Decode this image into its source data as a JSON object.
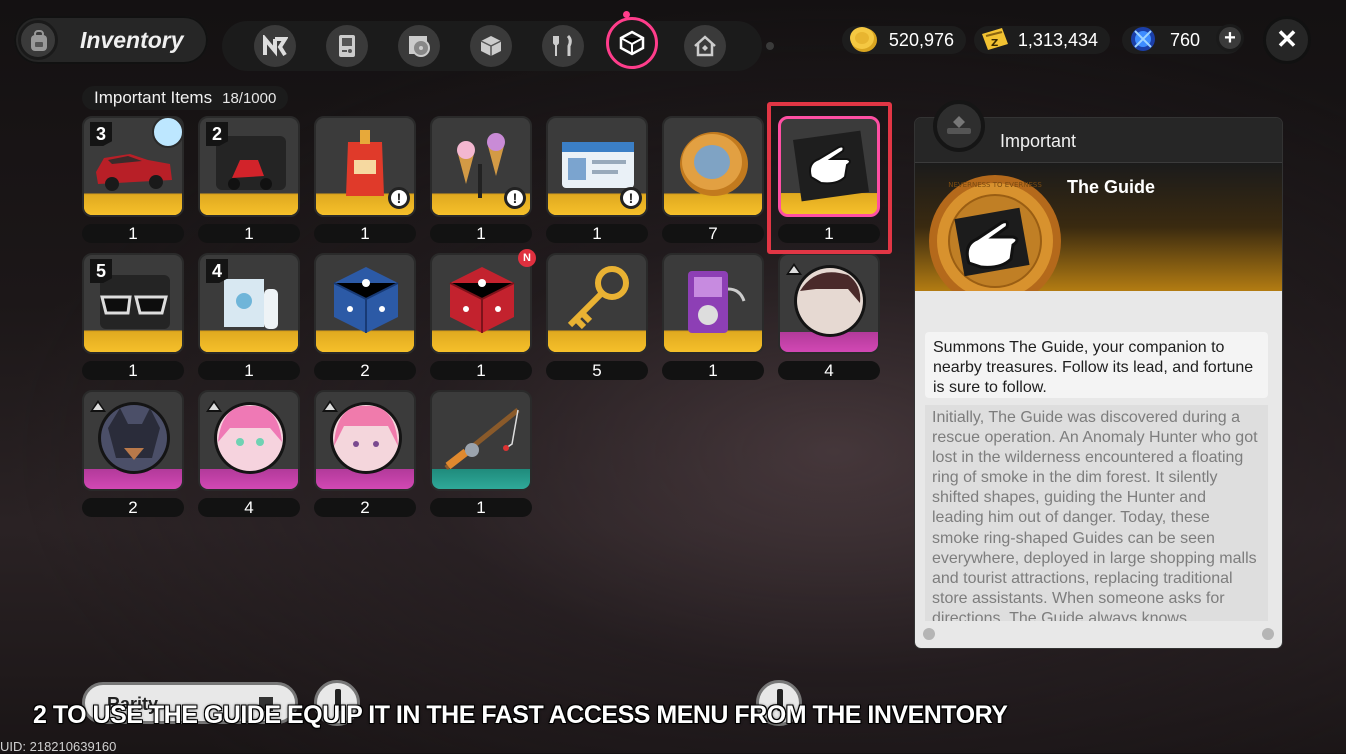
{
  "header": {
    "title": "Inventory"
  },
  "tabs": [
    {
      "name": "tab-bangboo",
      "icon": "n-logo-icon"
    },
    {
      "name": "tab-device",
      "icon": "gameboy-icon"
    },
    {
      "name": "tab-disc",
      "icon": "disc-icon"
    },
    {
      "name": "tab-materials",
      "icon": "cube-icon"
    },
    {
      "name": "tab-food",
      "icon": "fork-knife-icon"
    },
    {
      "name": "tab-important",
      "icon": "important-box-icon",
      "active": true
    },
    {
      "name": "tab-furniture",
      "icon": "house-icon"
    }
  ],
  "currencies": [
    {
      "icon": "dennies-coin-icon",
      "value": "520,976"
    },
    {
      "icon": "ticket-icon",
      "value": "1,313,434"
    },
    {
      "icon": "polychrome-icon",
      "value": "760"
    }
  ],
  "section": {
    "title": "Important Items",
    "count": "18/1000"
  },
  "items": [
    {
      "name": "car",
      "qty": "1",
      "badge": "3",
      "rarity": "gold"
    },
    {
      "name": "scooter",
      "qty": "1",
      "badge": "2",
      "rarity": "gold"
    },
    {
      "name": "drink-pouch",
      "qty": "1",
      "rarity": "gold",
      "alert": true
    },
    {
      "name": "ice-cream-stand",
      "qty": "1",
      "rarity": "gold",
      "alert": true
    },
    {
      "name": "id-card",
      "qty": "1",
      "rarity": "gold",
      "alert": true
    },
    {
      "name": "coin",
      "qty": "7",
      "rarity": "gold"
    },
    {
      "name": "the-guide",
      "qty": "1",
      "rarity": "gold",
      "selected": true
    },
    {
      "name": "sunglasses",
      "qty": "1",
      "badge": "5",
      "rarity": "gold"
    },
    {
      "name": "bottles",
      "qty": "1",
      "badge": "4",
      "rarity": "gold"
    },
    {
      "name": "blue-dice",
      "qty": "2",
      "rarity": "gold"
    },
    {
      "name": "red-dice",
      "qty": "1",
      "rarity": "gold",
      "new": "N"
    },
    {
      "name": "golden-key",
      "qty": "5",
      "rarity": "gold"
    },
    {
      "name": "music-player",
      "qty": "1",
      "rarity": "gold"
    },
    {
      "name": "portrait-man",
      "qty": "4",
      "rarity": "purple"
    },
    {
      "name": "portrait-wolf",
      "qty": "2",
      "rarity": "purple"
    },
    {
      "name": "portrait-pink-girl",
      "qty": "4",
      "rarity": "purple"
    },
    {
      "name": "portrait-pink-girl-2",
      "qty": "2",
      "rarity": "purple"
    },
    {
      "name": "fishing-rod",
      "qty": "1",
      "rarity": "teal"
    }
  ],
  "detail": {
    "category": "Important",
    "item_name": "The Guide",
    "medal_text": "NEVERNESS TO EVERNESS",
    "summary": "Summons The Guide, your companion to nearby treasures. Follow its lead, and fortune is sure to follow.",
    "lore": "Initially, The Guide was discovered during a rescue operation. An Anomaly Hunter who got lost in the wilderness encountered a floating ring of smoke in the dim forest. It silently shifted shapes, guiding the Hunter and leading him out of danger. Today, these smoke ring-shaped Guides can be seen everywhere, deployed in large shopping malls and tourist attractions, replacing traditional store assistants. When someone asks for directions, The Guide always knows"
  },
  "bottom": {
    "rarity_label": "Rarity"
  },
  "caption": "2 TO USE THE GUIDE EQUIP IT IN THE FAST ACCESS MENU FROM THE INVENTORY",
  "uid": "UID: 218210639160",
  "colors": {
    "accent": "#ff3d8b",
    "gold": "#f1b825",
    "purple": "#d248b4",
    "teal": "#2fa999",
    "selection": "#e23645"
  }
}
